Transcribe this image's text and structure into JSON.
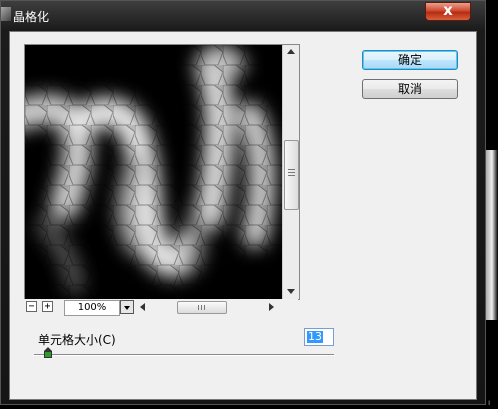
{
  "dialog": {
    "title": "晶格化",
    "close_label": "x"
  },
  "buttons": {
    "ok_label": "确定",
    "cancel_label": "取消"
  },
  "preview": {
    "zoom_out_label": "−",
    "zoom_in_label": "+",
    "zoom_value": "100%"
  },
  "parameters": {
    "cell_size_label": "单元格大小(C)",
    "cell_size_value": "13",
    "cell_size_slider_fraction": 0.04
  },
  "colors": {
    "accent": "#3399ff",
    "slider_thumb": "#2e9a2e",
    "close_button": "#c4402a"
  },
  "icons": [
    "app-icon",
    "close-icon",
    "zoom-out-icon",
    "zoom-in-icon",
    "dropdown-arrow-icon",
    "scroll-arrow-icons",
    "slider-thumb-icon"
  ]
}
